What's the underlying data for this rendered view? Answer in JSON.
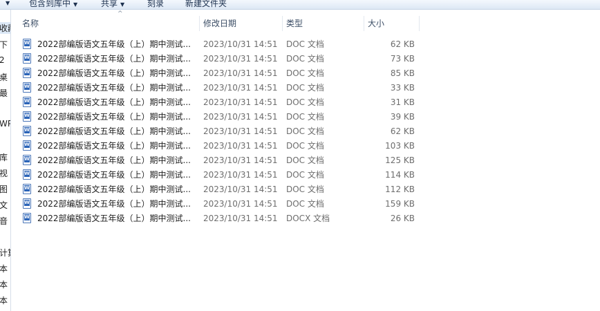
{
  "toolbar": {
    "items": [
      {
        "label": "",
        "caret": "▼"
      },
      {
        "label": "包含到库中",
        "caret": "▼"
      },
      {
        "label": "共享",
        "caret": "▼"
      },
      {
        "label": "刻录",
        "caret": ""
      },
      {
        "label": "新建文件夹",
        "caret": ""
      }
    ]
  },
  "nav": {
    "items": [
      "收藏",
      "下",
      "2",
      "桌",
      "最",
      "WP",
      "库",
      "视",
      "图",
      "文",
      "音",
      "计算",
      "本",
      "本",
      "本"
    ]
  },
  "columns": {
    "name": "名称",
    "date": "修改日期",
    "type": "类型",
    "size": "大小",
    "sort_arrow": "^"
  },
  "files": [
    {
      "name": "2022部编版语文五年级（上）期中测试...",
      "date": "2023/10/31 14:51",
      "type": "DOC 文档",
      "size": "62 KB"
    },
    {
      "name": "2022部编版语文五年级（上）期中测试...",
      "date": "2023/10/31 14:51",
      "type": "DOC 文档",
      "size": "73 KB"
    },
    {
      "name": "2022部编版语文五年级（上）期中测试...",
      "date": "2023/10/31 14:51",
      "type": "DOC 文档",
      "size": "85 KB"
    },
    {
      "name": "2022部编版语文五年级（上）期中测试...",
      "date": "2023/10/31 14:51",
      "type": "DOC 文档",
      "size": "33 KB"
    },
    {
      "name": "2022部编版语文五年级（上）期中测试...",
      "date": "2023/10/31 14:51",
      "type": "DOC 文档",
      "size": "31 KB"
    },
    {
      "name": "2022部编版语文五年级（上）期中测试...",
      "date": "2023/10/31 14:51",
      "type": "DOC 文档",
      "size": "39 KB"
    },
    {
      "name": "2022部编版语文五年级（上）期中测试...",
      "date": "2023/10/31 14:51",
      "type": "DOC 文档",
      "size": "62 KB"
    },
    {
      "name": "2022部编版语文五年级（上）期中测试...",
      "date": "2023/10/31 14:51",
      "type": "DOC 文档",
      "size": "103 KB"
    },
    {
      "name": "2022部编版语文五年级（上）期中测试...",
      "date": "2023/10/31 14:51",
      "type": "DOC 文档",
      "size": "125 KB"
    },
    {
      "name": "2022部编版语文五年级（上）期中测试...",
      "date": "2023/10/31 14:51",
      "type": "DOC 文档",
      "size": "114 KB"
    },
    {
      "name": "2022部编版语文五年级（上）期中测试...",
      "date": "2023/10/31 14:51",
      "type": "DOC 文档",
      "size": "112 KB"
    },
    {
      "name": "2022部编版语文五年级（上）期中测试...",
      "date": "2023/10/31 14:51",
      "type": "DOC 文档",
      "size": "159 KB"
    },
    {
      "name": "2022部编版语文五年级（上）期中测试...",
      "date": "2023/10/31 14:51",
      "type": "DOCX 文档",
      "size": "26 KB"
    }
  ]
}
